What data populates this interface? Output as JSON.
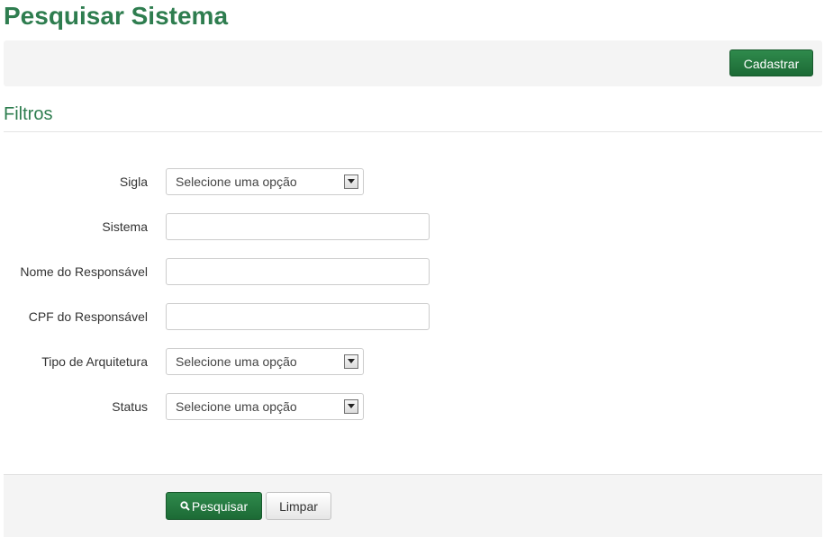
{
  "page": {
    "title": "Pesquisar Sistema"
  },
  "toolbar": {
    "cadastrar_label": "Cadastrar"
  },
  "filters": {
    "section_title": "Filtros",
    "fields": [
      {
        "label": "Sigla",
        "type": "select",
        "value": "Selecione uma opção"
      },
      {
        "label": "Sistema",
        "type": "text",
        "value": ""
      },
      {
        "label": "Nome do Responsável",
        "type": "text",
        "value": ""
      },
      {
        "label": "CPF do Responsável",
        "type": "text",
        "value": ""
      },
      {
        "label": "Tipo de Arquitetura",
        "type": "select",
        "value": "Selecione uma opção"
      },
      {
        "label": "Status",
        "type": "select",
        "value": "Selecione uma opção"
      }
    ]
  },
  "actions": {
    "pesquisar_label": "Pesquisar",
    "pesquisar_icon": "search-icon",
    "limpar_label": "Limpar"
  },
  "colors": {
    "title_green": "#2e7d4f",
    "button_green": "#1c6a35",
    "panel_gray": "#f4f4f4"
  }
}
